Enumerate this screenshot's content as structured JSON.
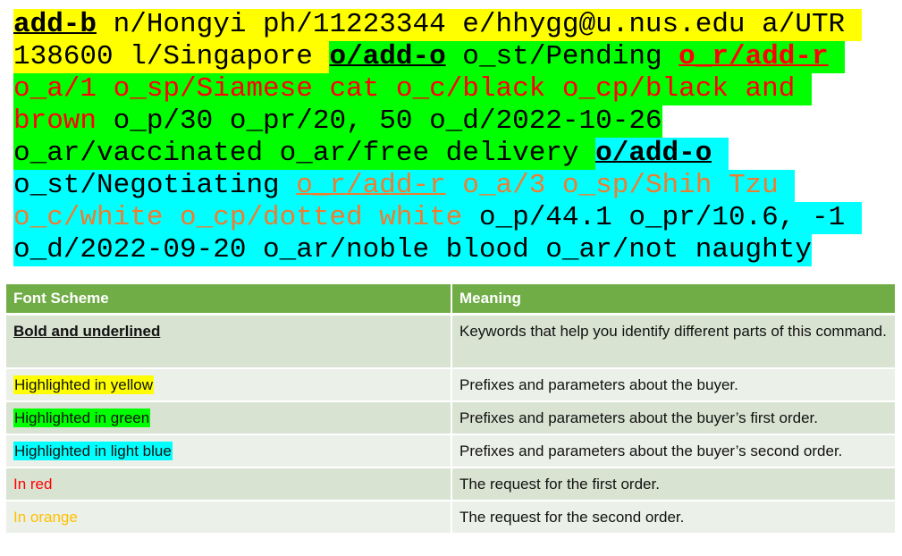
{
  "colors": {
    "yellow": "#ffff00",
    "green": "#00ff00",
    "cyan": "#00ffff",
    "red": "#ff0000",
    "orange": "#ed7d31",
    "black": "#000000",
    "table_header": "#70ad47",
    "orange_label": "#ffc000"
  },
  "command_lines": [
    [
      {
        "text": "add-b",
        "bg": "yellow",
        "color": "black",
        "bold": true,
        "ul": true
      },
      {
        "text": " n/Hongyi ph/11223344 e/hhygg@u.nus.edu a/UTR ",
        "bg": "yellow",
        "color": "black"
      }
    ],
    [
      {
        "text": "138600 l/Singapore ",
        "bg": "yellow",
        "color": "black"
      },
      {
        "text": "o/add-o",
        "bg": "green",
        "color": "black",
        "bold": true,
        "ul": true
      },
      {
        "text": " o_st/Pending ",
        "bg": "green",
        "color": "black"
      },
      {
        "text": "o_r/add-r",
        "bg": "green",
        "color": "red",
        "bold": true,
        "ul": true
      },
      {
        "text": " ",
        "bg": "green",
        "color": "black"
      }
    ],
    [
      {
        "text": "o_a/1 o_sp/Siamese cat o_c/black o_cp/black and ",
        "bg": "green",
        "color": "red"
      }
    ],
    [
      {
        "text": "brown",
        "bg": "green",
        "color": "red"
      },
      {
        "text": " o_p/30 o_pr/20, 50 o_d/2022-10-26",
        "bg": "green",
        "color": "black"
      }
    ],
    [
      {
        "text": "o_ar/vaccinated o_ar/free delivery ",
        "bg": "green",
        "color": "black"
      },
      {
        "text": "o/add-o",
        "bg": "cyan",
        "color": "black",
        "bold": true,
        "ul": true
      },
      {
        "text": " ",
        "bg": "cyan",
        "color": "black"
      }
    ],
    [
      {
        "text": "o_st/Negotiating ",
        "bg": "cyan",
        "color": "black"
      },
      {
        "text": "o_r/add-r",
        "bg": "cyan",
        "color": "orange",
        "ul": true
      },
      {
        "text": " o_a/3 o_sp/Shih Tzu ",
        "bg": "cyan",
        "color": "orange"
      }
    ],
    [
      {
        "text": "o_c/white o_cp/dotted white",
        "bg": "cyan",
        "color": "orange"
      },
      {
        "text": " o_p/44.1 o_pr/10.6, -1 ",
        "bg": "cyan",
        "color": "black"
      }
    ],
    [
      {
        "text": "o_d/2022-09-20 o_ar/noble blood o_ar/not naughty",
        "bg": "cyan",
        "color": "black"
      }
    ]
  ],
  "table": {
    "headers": [
      "Font Scheme",
      "Meaning"
    ],
    "rows": [
      {
        "scheme": "Bold and underlined",
        "meaning": "Keywords that help you identify different parts of this command."
      },
      {
        "scheme": "Highlighted in yellow",
        "meaning": "Prefixes and parameters about the buyer."
      },
      {
        "scheme": "Highlighted in green",
        "meaning": "Prefixes and parameters about the buyer’s first order."
      },
      {
        "scheme": "Highlighted in light blue",
        "meaning": "Prefixes and parameters about the buyer’s second order."
      },
      {
        "scheme": "In red",
        "meaning": "The request for the first order."
      },
      {
        "scheme": "In orange",
        "meaning": "The request for the second order."
      }
    ]
  }
}
